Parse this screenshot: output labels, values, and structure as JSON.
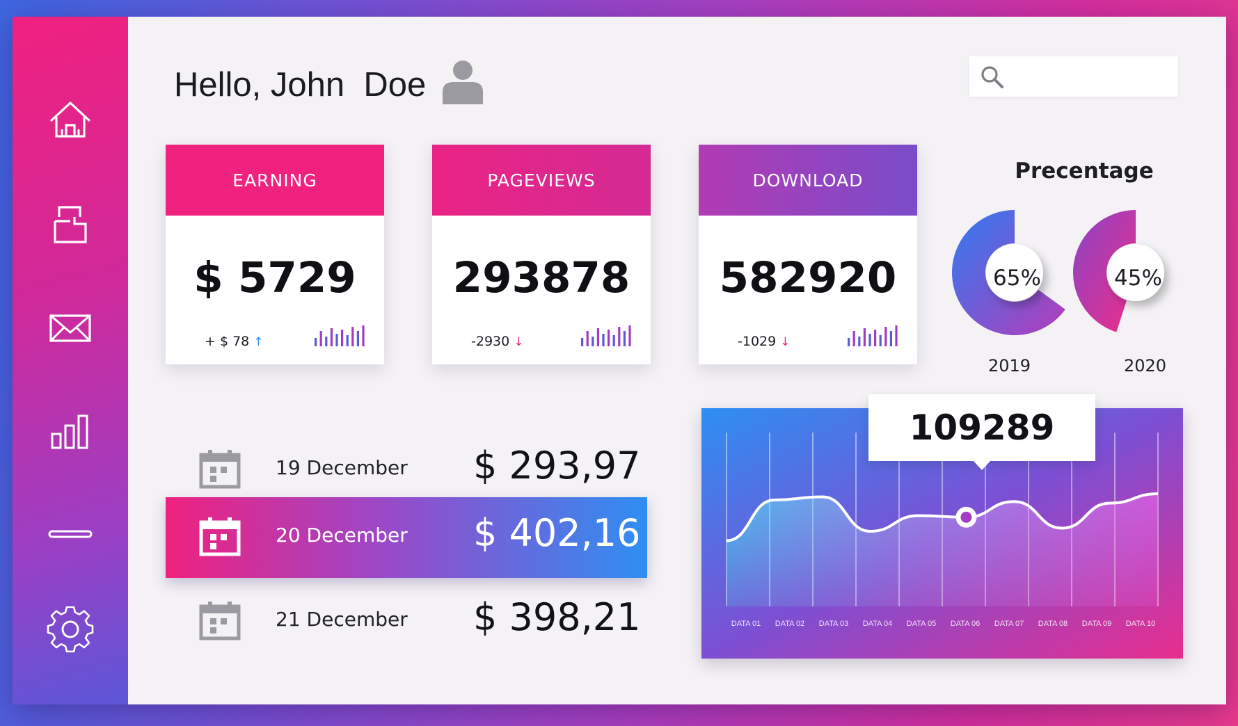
{
  "header": {
    "greeting": "Hello, John  Doe",
    "search_placeholder": ""
  },
  "sidebar": {
    "items": [
      {
        "name": "home-icon",
        "label": "Home"
      },
      {
        "name": "folder-icon",
        "label": "Files"
      },
      {
        "name": "mail-icon",
        "label": "Mail"
      },
      {
        "name": "bar-chart-icon",
        "label": "Statistics"
      },
      {
        "name": "minus-icon",
        "label": "Minimize"
      },
      {
        "name": "gear-icon",
        "label": "Settings"
      }
    ]
  },
  "cards": [
    {
      "title": "EARNING",
      "value": "$ 5729",
      "delta": "+ $ 78",
      "direction": "up"
    },
    {
      "title": "PAGEVIEWS",
      "value": "293878",
      "delta": "-2930",
      "direction": "down"
    },
    {
      "title": "DOWNLOAD",
      "value": "582920",
      "delta": "-1029",
      "direction": "down"
    }
  ],
  "percentage": {
    "title": "Precentage",
    "items": [
      {
        "year": "2019",
        "value": "65%",
        "fraction": 0.65,
        "color_from": "#2f7bf0",
        "color_to": "#a23cc4"
      },
      {
        "year": "2020",
        "value": "45%",
        "fraction": 0.45,
        "color_from": "#a23cc4",
        "color_to": "#e82d8e"
      }
    ]
  },
  "transactions": [
    {
      "date": "19 December",
      "amount": "$ 293,97",
      "active": false
    },
    {
      "date": "20 December",
      "amount": "$ 402,16",
      "active": true
    },
    {
      "date": "21 December",
      "amount": "$ 398,21",
      "active": false
    }
  ],
  "chart_data": {
    "type": "area",
    "highlight_value": "109289",
    "categories": [
      "DATA 01",
      "DATA 02",
      "DATA 03",
      "DATA 04",
      "DATA 05",
      "DATA 06",
      "DATA 07",
      "DATA 08",
      "DATA 09",
      "DATA 10"
    ],
    "values": [
      42,
      68,
      70,
      48,
      58,
      57,
      67,
      50,
      66,
      72
    ],
    "highlight_index": 5,
    "grid": "vertical"
  },
  "colors": {
    "pink": "#f0217f",
    "magenta": "#c52da3",
    "violet": "#8a44c6",
    "blue": "#2f8ef2",
    "icon_gray": "#9a9aa0"
  }
}
